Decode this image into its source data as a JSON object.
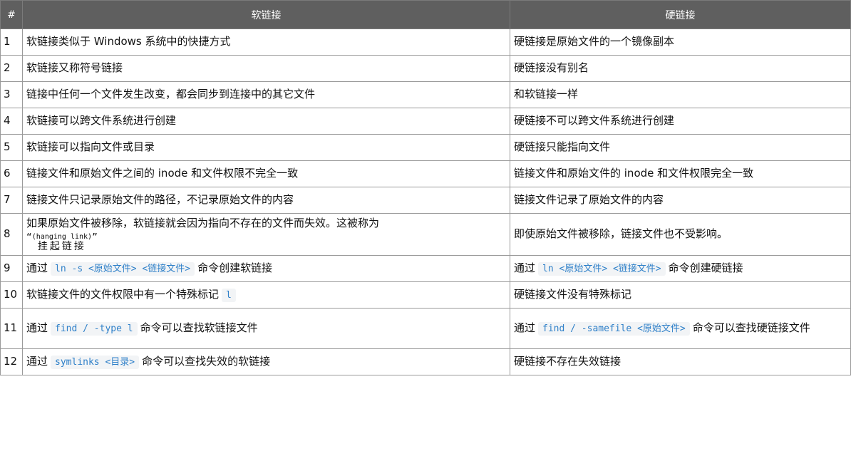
{
  "table": {
    "headers": [
      "#",
      "软链接",
      "硬链接"
    ],
    "rows": [
      {
        "n": "1",
        "soft": "软链接类似于 Windows 系统中的快捷方式",
        "hard": "硬链接是原始文件的一个镜像副本"
      },
      {
        "n": "2",
        "soft": "软链接又称符号链接",
        "hard": "硬链接没有别名"
      },
      {
        "n": "3",
        "soft": "链接中任何一个文件发生改变，都会同步到连接中的其它文件",
        "hard": "和软链接一样"
      },
      {
        "n": "4",
        "soft": "软链接可以跨文件系统进行创建",
        "hard": "硬链接不可以跨文件系统进行创建"
      },
      {
        "n": "5",
        "soft": "软链接可以指向文件或目录",
        "hard": "硬链接只能指向文件"
      },
      {
        "n": "6",
        "soft": "链接文件和原始文件之间的 inode 和文件权限不完全一致",
        "hard": "链接文件和原始文件的 inode 和文件权限完全一致"
      },
      {
        "n": "7",
        "soft": "链接文件只记录原始文件的路径，不记录原始文件的内容",
        "hard": "链接文件记录了原始文件的内容"
      },
      {
        "n": "8",
        "soft_text": "如果原始文件被移除，软链接就会因为指向不存在的文件而失效。这被称为",
        "soft_quote_open": "“",
        "soft_ruby_base": "挂起链接",
        "soft_ruby_text": "(hanging link)",
        "soft_quote_close": "”",
        "hard": "即使原始文件被移除，链接文件也不受影响。"
      },
      {
        "n": "9",
        "soft_pre": "通过",
        "soft_code": "ln -s <原始文件> <链接文件>",
        "soft_post": "命令创建软链接",
        "hard_pre": "通过",
        "hard_code": "ln <原始文件> <链接文件>",
        "hard_post": "命令创建硬链接"
      },
      {
        "n": "10",
        "soft_pre": "软链接文件的文件权限中有一个特殊标记",
        "soft_code": "l",
        "hard": "硬链接文件没有特殊标记"
      },
      {
        "n": "11",
        "soft_pre": "通过",
        "soft_code": "find / -type l",
        "soft_post": "命令可以查找软链接文件",
        "hard_pre": "通过",
        "hard_code": "find / -samefile <原始文件>",
        "hard_post": "命令可以查找硬链接文件"
      },
      {
        "n": "12",
        "soft_pre": "通过",
        "soft_code": "symlinks <目录>",
        "soft_post": "命令可以查找失效的软链接",
        "hard": "硬链接不存在失效链接"
      }
    ]
  }
}
